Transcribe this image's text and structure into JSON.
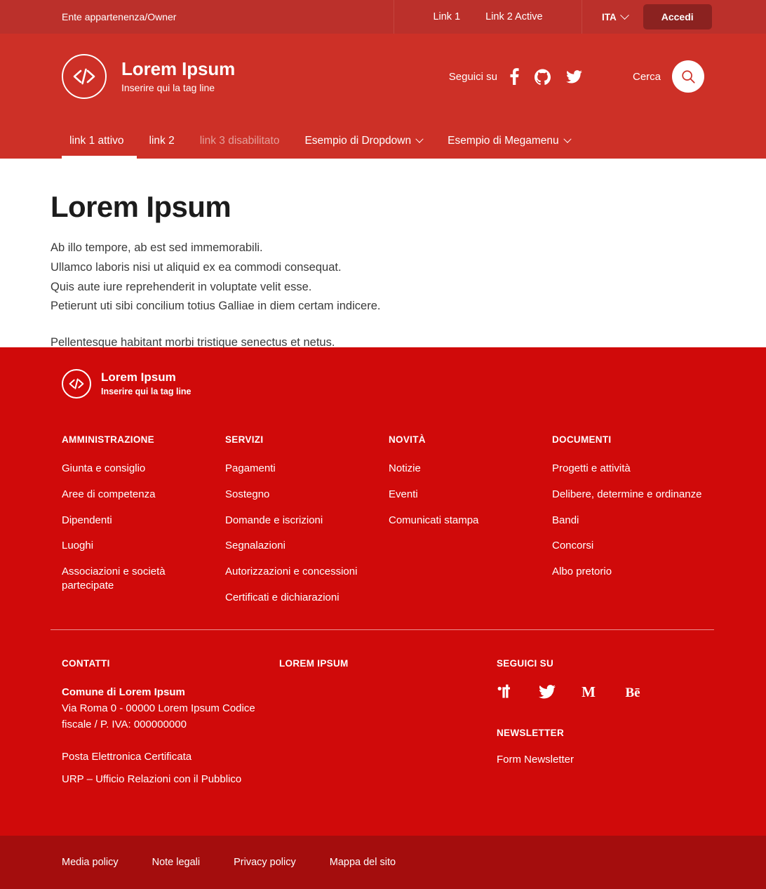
{
  "topbar": {
    "owner": "Ente appartenenza/Owner",
    "links": [
      {
        "label": "Link 1"
      },
      {
        "label": "Link 2 Active"
      }
    ],
    "lang": "ITA",
    "login_label": "Accedi"
  },
  "header": {
    "brand_title": "Lorem Ipsum",
    "brand_tagline": "Inserire qui la tag line",
    "follow_label": "Seguici su",
    "search_label": "Cerca",
    "socials": [
      {
        "name": "facebook-icon"
      },
      {
        "name": "github-icon"
      },
      {
        "name": "twitter-icon"
      }
    ]
  },
  "nav": {
    "items": [
      {
        "label": "link 1 attivo",
        "state": "active"
      },
      {
        "label": "link 2",
        "state": "default"
      },
      {
        "label": "link 3 disabilitato",
        "state": "disabled"
      },
      {
        "label": "Esempio di Dropdown",
        "state": "dropdown"
      },
      {
        "label": "Esempio di Megamenu",
        "state": "dropdown"
      }
    ]
  },
  "main": {
    "title": "Lorem Ipsum",
    "paragraphs": [
      "Ab illo tempore, ab est sed immemorabili.",
      "Ullamco laboris nisi ut aliquid ex ea commodi consequat.",
      "Quis aute iure reprehenderit in voluptate velit esse.",
      "Petierunt uti sibi concilium totius Galliae in diem certam indicere."
    ],
    "closing": "Pellentesque habitant morbi tristique senectus et netus."
  },
  "footer": {
    "brand_title": "Lorem Ipsum",
    "brand_tagline": "Inserire qui la tag line",
    "columns": [
      {
        "heading": "AMMINISTRAZIONE",
        "links": [
          "Giunta e consiglio",
          "Aree di competenza",
          "Dipendenti",
          "Luoghi",
          "Associazioni e società partecipate"
        ]
      },
      {
        "heading": "SERVIZI",
        "links": [
          "Pagamenti",
          "Sostegno",
          "Domande e iscrizioni",
          "Segnalazioni",
          "Autorizzazioni e concessioni",
          "Certificati e dichiarazioni"
        ]
      },
      {
        "heading": "NOVITÀ",
        "links": [
          "Notizie",
          "Eventi",
          "Comunicati stampa"
        ]
      },
      {
        "heading": "DOCUMENTI",
        "links": [
          "Progetti e attività",
          "Delibere, determine e ordinanze",
          "Bandi",
          "Concorsi",
          "Albo pretorio"
        ]
      }
    ],
    "contatti": {
      "heading": "CONTATTI",
      "org_name": "Comune di Lorem Ipsum",
      "address": "Via Roma 0 - 00000 Lorem Ipsum Codice fiscale / P. IVA: 000000000",
      "links": [
        "Posta Elettronica Certificata",
        "URP – Ufficio Relazioni con il Pubblico"
      ]
    },
    "lorem_col": {
      "heading": "LOREM IPSUM"
    },
    "seguici": {
      "heading": "SEGUICI SU",
      "socials": [
        {
          "name": "it-icon"
        },
        {
          "name": "twitter-icon"
        },
        {
          "name": "medium-icon"
        },
        {
          "name": "behance-icon"
        }
      ]
    },
    "newsletter": {
      "heading": "NEWSLETTER",
      "link": "Form Newsletter"
    }
  },
  "bottombar": {
    "links": [
      "Media policy",
      "Note legali",
      "Privacy policy",
      "Mappa del sito"
    ]
  },
  "colors": {
    "topbar": "#bb302b",
    "header": "#cd3027",
    "footer": "#d00a0a",
    "bottombar": "#a40d0d",
    "accedi_button": "#8b2220"
  }
}
